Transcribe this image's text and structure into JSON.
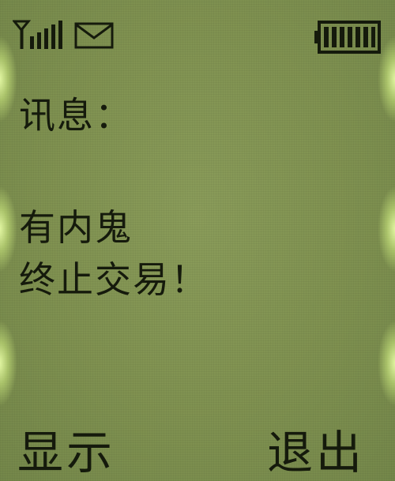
{
  "status_bar": {
    "signal_icon": "signal-strength-icon",
    "message_icon": "envelope-icon",
    "battery_icon": "battery-full-icon"
  },
  "message": {
    "heading": "讯息：",
    "lines": [
      "有内鬼",
      "终止交易！"
    ]
  },
  "softkeys": {
    "left_label": "显示",
    "right_label": "退出"
  },
  "colors": {
    "screen_background": "#7f9150",
    "text": "#151a0c",
    "backlight_glow": "#ebffaa"
  }
}
